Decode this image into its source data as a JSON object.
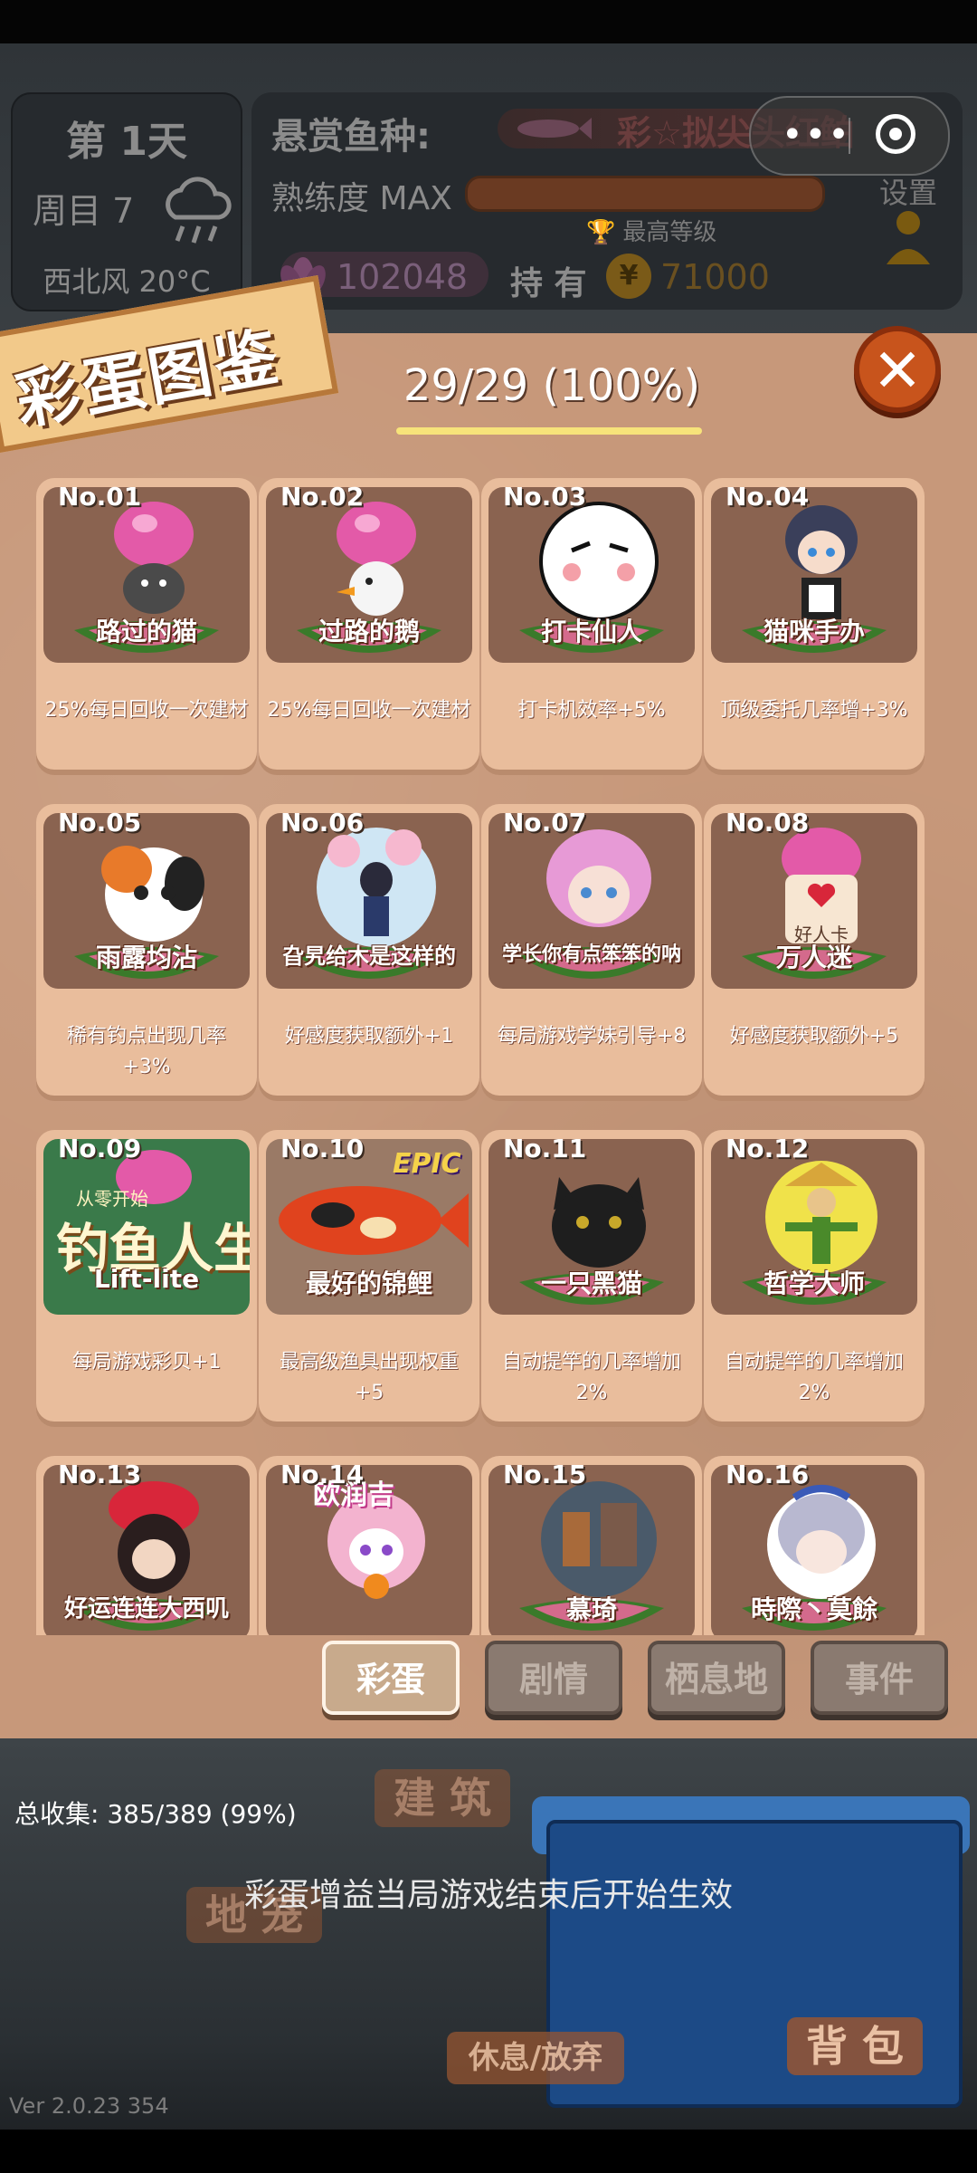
{
  "hud": {
    "day": "第 1天",
    "cycle": "周目 7",
    "wind": "西北风 20°C",
    "bounty_label": "悬赏鱼种:",
    "bounty_fish": "彩☆拟尖头红鲌",
    "proficiency_label": "熟练度 MAX",
    "proficiency_sub": "最高等级",
    "lotus_value": "102048",
    "hold_label": "持 有",
    "coin_value": "71000",
    "settings_label": "设置"
  },
  "panel": {
    "title": "彩蛋图鉴",
    "progress": "29/29 (100%)"
  },
  "cards": [
    {
      "no": "No.01",
      "name": "路过的猫",
      "desc": "25%每日回收一次建材"
    },
    {
      "no": "No.02",
      "name": "过路的鹅",
      "desc": "25%每日回收一次建材"
    },
    {
      "no": "No.03",
      "name": "打卡仙人",
      "desc": "打卡机效率+5%"
    },
    {
      "no": "No.04",
      "name": "猫咪手办",
      "desc": "顶级委托几率增+3%"
    },
    {
      "no": "No.05",
      "name": "雨露均沾",
      "desc": "稀有钓点出现几率+3%"
    },
    {
      "no": "No.06",
      "name": "旮旯给木是这样的",
      "desc": "好感度获取额外+1"
    },
    {
      "no": "No.07",
      "name": "学长你有点笨笨的呐",
      "desc": "每局游戏学妹引导+8"
    },
    {
      "no": "No.08",
      "name": "万人迷",
      "desc": "好感度获取额外+5"
    },
    {
      "no": "No.09",
      "name": "Lift-lite",
      "desc": "每局游戏彩贝+1"
    },
    {
      "no": "No.10",
      "name": "最好的锦鲤",
      "desc": "最高级渔具出现权重+5"
    },
    {
      "no": "No.11",
      "name": "一只黑猫",
      "desc": "自动提竿的几率增加2%"
    },
    {
      "no": "No.12",
      "name": "哲学大师",
      "desc": "自动提竿的几率增加2%"
    },
    {
      "no": "No.13",
      "name": "好运连连大西叽",
      "desc": ""
    },
    {
      "no": "No.14",
      "name": "",
      "desc": ""
    },
    {
      "no": "No.15",
      "name": "慕琦",
      "desc": ""
    },
    {
      "no": "No.16",
      "name": "時際丶莫餘",
      "desc": ""
    }
  ],
  "card_extras": {
    "card08_badge": "好人卡",
    "card09_banner_top": "从零开始",
    "card09_banner_big": "钓鱼人生",
    "card10_epic": "EPIC",
    "card14_tag": "欧润吉"
  },
  "tabs": [
    "彩蛋",
    "剧情",
    "栖息地",
    "事件"
  ],
  "bottom": {
    "total_collect": "总收集: 385/389 (99%)",
    "effect_note": "彩蛋增益当局游戏结束后开始生效",
    "btn_build": "建 筑",
    "btn_cage": "地 笼",
    "btn_rest": "休息/放弃",
    "btn_bag": "背 包",
    "version": "Ver 2.0.23 354"
  },
  "colors": {
    "panel": "#c7987a",
    "card": "#e9bd9c",
    "accent_close": "#c8541c",
    "progress_line": "#f7e37a"
  },
  "icons": [
    "weather-rain-icon",
    "fish-icon",
    "trophy-icon",
    "lotus-icon",
    "coin-icon",
    "more-icon",
    "target-icon",
    "user-icon",
    "close-icon"
  ]
}
